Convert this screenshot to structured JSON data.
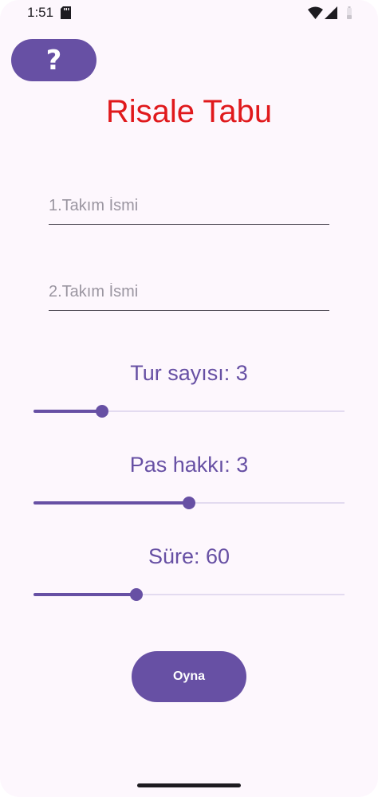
{
  "status_bar": {
    "time": "1:51",
    "icons": [
      "sd-card-icon",
      "wifi-icon",
      "signal-icon",
      "battery-icon"
    ]
  },
  "help_button": {
    "label": "?"
  },
  "title": "Risale Tabu",
  "team1": {
    "value": "",
    "placeholder": "1.Takım İsmi"
  },
  "team2": {
    "value": "",
    "placeholder": "2.Takım İsmi"
  },
  "rounds": {
    "label": "Tur sayısı: 3",
    "fraction": 0.22
  },
  "passes": {
    "label": "Pas hakkı: 3",
    "fraction": 0.5
  },
  "time": {
    "label": "Süre: 60",
    "fraction": 0.33
  },
  "play_button": {
    "label": "Oyna"
  },
  "colors": {
    "primary": "#6750a4",
    "title": "#e0191c",
    "background": "#fdf7fd",
    "track_inactive": "#e3dbf0"
  }
}
